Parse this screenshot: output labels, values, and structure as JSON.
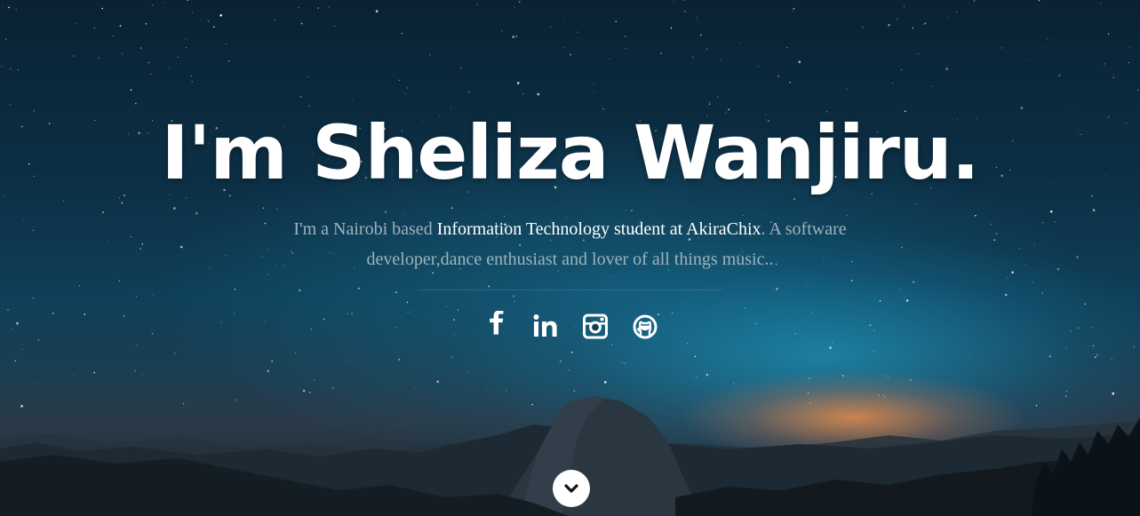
{
  "hero": {
    "headline": "I'm Sheliza Wanjiru.",
    "intro": {
      "part1": "I'm a Nairobi based ",
      "highlight": "Information Technology student at AkiraChix",
      "part2": ". A software developer,dance enthusiast and lover of all things music.."
    }
  },
  "social": [
    {
      "name": "facebook",
      "icon": "facebook-icon"
    },
    {
      "name": "linkedin",
      "icon": "linkedin-icon"
    },
    {
      "name": "instagram",
      "icon": "instagram-icon"
    },
    {
      "name": "github",
      "icon": "github-icon"
    }
  ],
  "scroll_down": {
    "icon": "chevron-down-icon"
  },
  "colors": {
    "text_primary": "#ffffff",
    "text_muted": "#9fb3bd",
    "sky_top": "#0a2233",
    "sky_glow": "#21aad2",
    "horizon_glow": "#e88c4a"
  }
}
